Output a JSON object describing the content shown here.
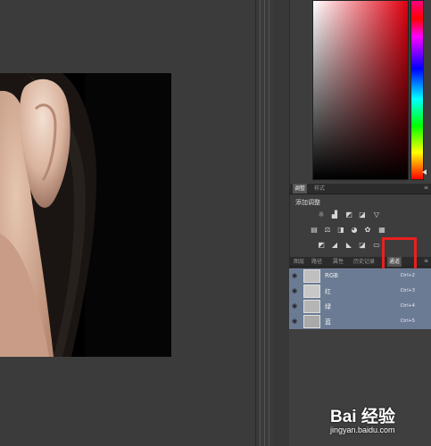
{
  "adjust_panel": {
    "tabs": [
      "调整",
      "样式"
    ],
    "title": "添加调整"
  },
  "channels_panel": {
    "tabs": [
      "图层",
      "路径",
      "属性",
      "历史记录",
      "通道"
    ],
    "active_tab": "通道",
    "channels": [
      {
        "name": "RGB",
        "shortcut": "Ctrl+2"
      },
      {
        "name": "红",
        "shortcut": "Ctrl+3"
      },
      {
        "name": "绿",
        "shortcut": "Ctrl+4"
      },
      {
        "name": "蓝",
        "shortcut": "Ctrl+5"
      }
    ]
  },
  "highlight_color": "#e8201f",
  "watermark": {
    "logo": "Bai 经验",
    "url": "jingyan.baidu.com"
  }
}
